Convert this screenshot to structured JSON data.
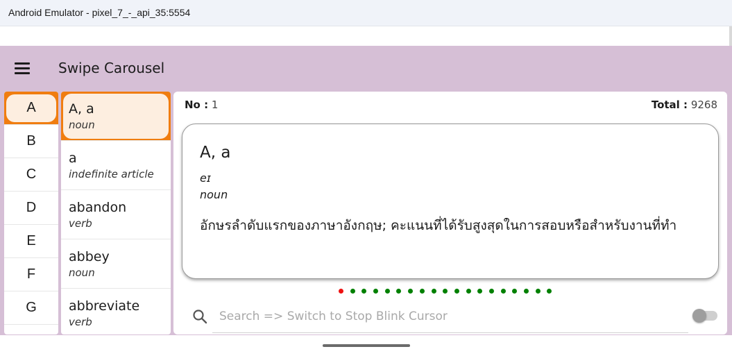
{
  "window": {
    "title": "Android Emulator - pixel_7_-_api_35:5554"
  },
  "appbar": {
    "title": "Swipe Carousel",
    "menu_icon": "hamburger-menu-icon"
  },
  "letters": {
    "items": [
      "A",
      "B",
      "C",
      "D",
      "E",
      "F",
      "G"
    ],
    "selected": "A"
  },
  "words": {
    "items": [
      {
        "word": "A, a",
        "pos": "noun"
      },
      {
        "word": "a",
        "pos": "indefinite article"
      },
      {
        "word": "abandon",
        "pos": "verb"
      },
      {
        "word": "abbey",
        "pos": "noun"
      },
      {
        "word": "abbreviate",
        "pos": "verb"
      }
    ],
    "selected_index": 0
  },
  "header": {
    "no_label": "No :",
    "no_value": "1",
    "total_label": "Total :",
    "total_value": "9268"
  },
  "card": {
    "word": "A, a",
    "pronunciation": "eɪ",
    "pos": "noun",
    "meaning": "อักษรลำดับแรกของภาษาอังกฤษ; คะแนนที่ได้รับสูงสุดในการสอบหรือสำหรับงานที่ทำ"
  },
  "pager": {
    "count": 19,
    "active_index": 0,
    "active_color": "#ee1111",
    "inactive_color": "#008000"
  },
  "search": {
    "placeholder": "Search => Switch to Stop Blink Cursor",
    "value": "",
    "icon": "search-icon",
    "toggle_on": false
  },
  "colors": {
    "appbar": "#d6bfd6",
    "selected_accent": "#f07d10",
    "selected_fill": "#fdeee0"
  }
}
